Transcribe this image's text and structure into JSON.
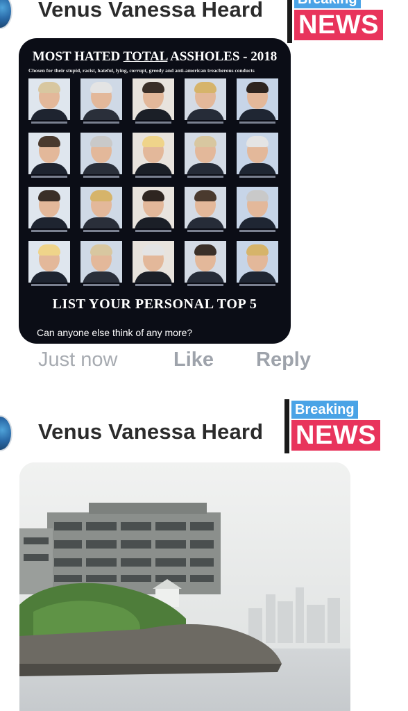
{
  "comments": [
    {
      "author": "Venus Vanessa Heard",
      "badge": {
        "top": "Breaking",
        "bottom": "NEWS"
      },
      "meme": {
        "title_pre": "MOST HATED ",
        "title_underlined": "TOTAL",
        "title_post": " ASSHOLES - 2018",
        "subtitle": "Chosen for their stupid, racist, hateful, lying, corrupt, greedy and anti-american treacherous conducts",
        "footer": "LIST YOUR PERSONAL TOP 5",
        "caption": "Can anyone else think of any more?",
        "rows": 4,
        "cols": 5
      },
      "timestamp": "Just now",
      "like_label": "Like",
      "reply_label": "Reply"
    },
    {
      "author": "Venus Vanessa Heard",
      "badge": {
        "top": "Breaking",
        "bottom": "NEWS"
      }
    }
  ],
  "colors": {
    "breaking_bg": "#4aa3e6",
    "news_bg": "#e8345c",
    "author_text": "#2b2b2b",
    "action_text": "#9ea3ab",
    "meme_bg": "#0b0d16"
  }
}
